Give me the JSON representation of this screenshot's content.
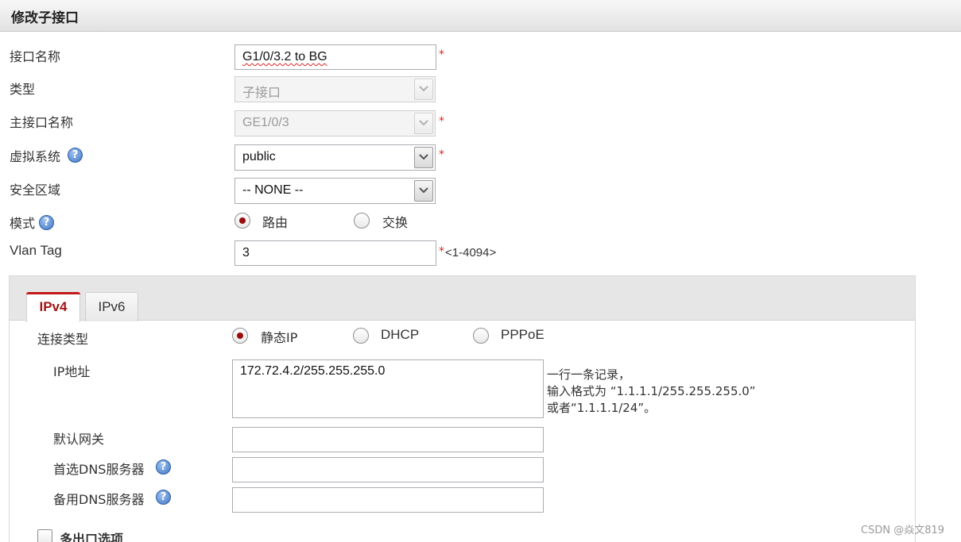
{
  "dialog": {
    "title": "修改子接口"
  },
  "form": {
    "interface_name_label": "接口名称",
    "interface_name_value": "G1/0/3.2 to BG",
    "type_label": "类型",
    "type_value": "子接口",
    "parent_interface_label": "主接口名称",
    "parent_interface_value": "GE1/0/3",
    "vsys_label": "虚拟系统",
    "vsys_value": "public",
    "zone_label": "安全区域",
    "zone_value": "-- NONE --",
    "mode_label": "模式",
    "mode_options": [
      "路由",
      "交换"
    ],
    "mode_selected": "路由",
    "vlan_label": "Vlan Tag",
    "vlan_value": "3",
    "vlan_range": "<1-4094>",
    "required_mark": "*",
    "help_glyph": "?"
  },
  "tabs": [
    {
      "label": "IPv4",
      "active": true
    },
    {
      "label": "IPv6",
      "active": false
    }
  ],
  "ipv4": {
    "conn_type_label": "连接类型",
    "conn_options": [
      "静态IP",
      "DHCP",
      "PPPoE"
    ],
    "conn_selected": "静态IP",
    "ip_label": "IP地址",
    "ip_value": "172.72.4.2/255.255.255.0",
    "ip_hint_lines": [
      "一行一条记录，",
      "输入格式为 “1.1.1.1/255.255.255.0”",
      "或者“1.1.1.1/24”。"
    ],
    "gateway_label": "默认网关",
    "gateway_value": "",
    "dns1_label": "首选DNS服务器",
    "dns1_value": "",
    "dns2_label": "备用DNS服务器",
    "dns2_value": "",
    "multi_exit_label": "多出口选项",
    "multi_exit_checked": false
  },
  "watermark": "CSDN @焱文819",
  "colors": {
    "required": "#e02020",
    "active_tab": "#a31515",
    "radio_dot": "#9b0d0d",
    "help_icon": "#3f76c4"
  },
  "icons": {
    "help": "question-circle-icon",
    "dropdown": "chevron-down-icon"
  }
}
